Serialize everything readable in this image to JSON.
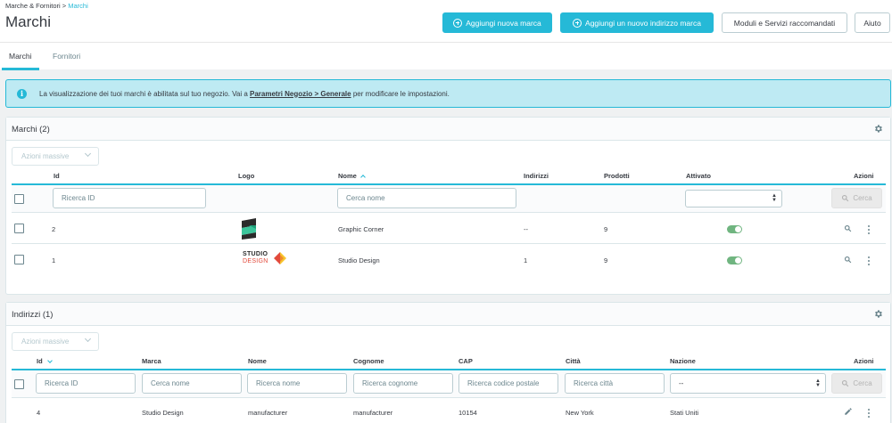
{
  "breadcrumb": {
    "parent": "Marche & Fornitori",
    "separator": " > ",
    "current": "Marchi"
  },
  "page": {
    "title": "Marchi"
  },
  "toolbar": {
    "add_brand": "Aggiungi nuova marca",
    "add_address": "Aggiungi un nuovo indirizzo marca",
    "modules": "Moduli e Servizi raccomandati",
    "help": "Aiuto"
  },
  "tabs": [
    {
      "label": "Marchi",
      "active": true
    },
    {
      "label": "Fornitori",
      "active": false
    }
  ],
  "alert": {
    "text_before": "La visualizzazione dei tuoi marchi è abilitata sul tuo negozio. Vai a ",
    "link": "Parametri Negozio > Generale",
    "text_after": " per modificare le impostazioni."
  },
  "brands": {
    "title": "Marchi (2)",
    "bulk_label": "Azioni massive",
    "columns": {
      "id": "Id",
      "logo": "Logo",
      "name": "Nome",
      "addresses": "Indirizzi",
      "products": "Prodotti",
      "enabled": "Attivato",
      "actions": "Azioni"
    },
    "filters": {
      "id_placeholder": "Ricerca ID",
      "name_placeholder": "Cerca nome",
      "search_button": "Cerca"
    },
    "rows": [
      {
        "id": "2",
        "name": "Graphic Corner",
        "addresses": "--",
        "products": "9",
        "enabled": true,
        "logo": "graphic-corner"
      },
      {
        "id": "1",
        "name": "Studio Design",
        "addresses": "1",
        "products": "9",
        "enabled": true,
        "logo": "studio-design",
        "logo_line1": "STUDIO",
        "logo_line2": "DESIGN"
      }
    ]
  },
  "addresses": {
    "title": "Indirizzi (1)",
    "bulk_label": "Azioni massive",
    "columns": {
      "id": "Id",
      "brand": "Marca",
      "first_name": "Nome",
      "last_name": "Cognome",
      "zip": "CAP",
      "city": "Città",
      "country": "Nazione",
      "actions": "Azioni"
    },
    "filters": {
      "id_placeholder": "Ricerca ID",
      "brand_placeholder": "Cerca nome",
      "first_name_placeholder": "Ricerca nome",
      "last_name_placeholder": "Ricerca cognome",
      "zip_placeholder": "Ricerca codice postale",
      "city_placeholder": "Ricerca città",
      "country_selected": "--",
      "search_button": "Cerca"
    },
    "rows": [
      {
        "id": "4",
        "brand": "Studio Design",
        "first_name": "manufacturer",
        "last_name": "manufacturer",
        "zip": "10154",
        "city": "New York",
        "country": "Stati Uniti"
      }
    ]
  },
  "colors": {
    "primary": "#25b9d7",
    "toggle_on": "#70b580",
    "text": "#363a41",
    "muted": "#6c868e"
  }
}
